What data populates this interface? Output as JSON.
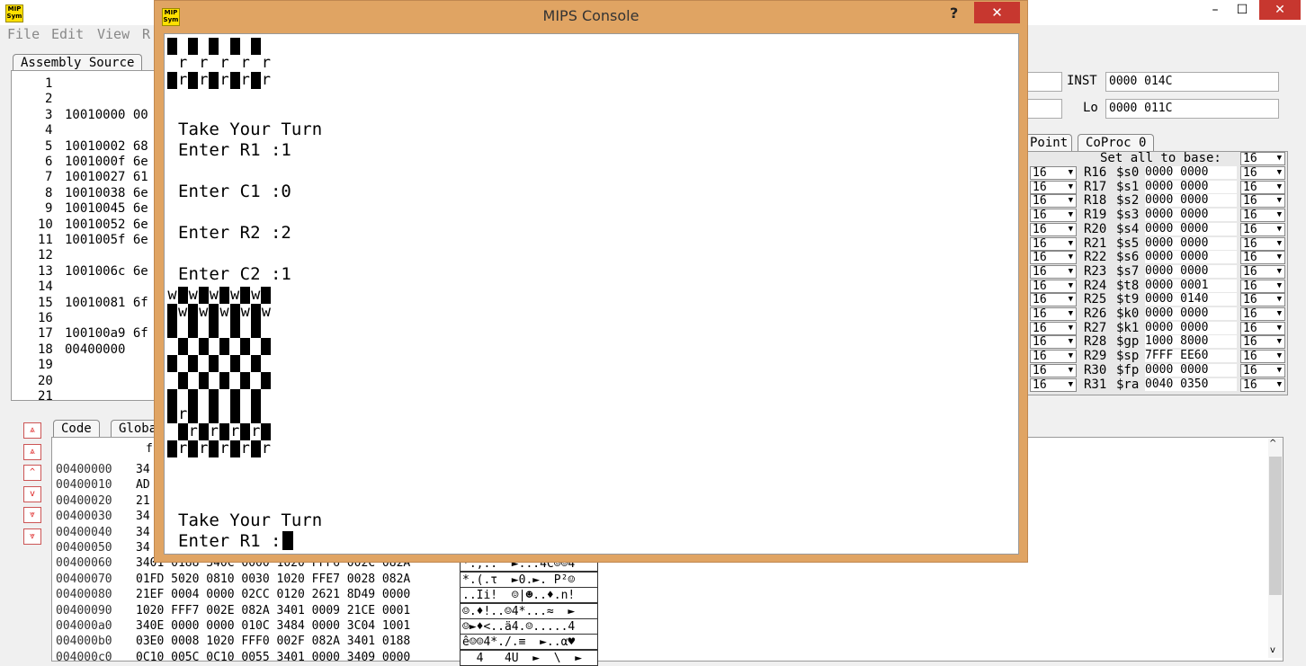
{
  "main_window": {
    "menu": [
      "File",
      "Edit",
      "View",
      "R"
    ],
    "window_controls": [
      "–",
      "☐",
      "✕"
    ]
  },
  "assembly_tab": "Assembly Source",
  "assembly_lines": [
    {
      "n": "1",
      "text": ""
    },
    {
      "n": "2",
      "text": ""
    },
    {
      "n": "3",
      "text": "10010000 00"
    },
    {
      "n": "4",
      "text": ""
    },
    {
      "n": "5",
      "text": "10010002 68"
    },
    {
      "n": "6",
      "text": "1001000f 6e"
    },
    {
      "n": "7",
      "text": "10010027 61"
    },
    {
      "n": "8",
      "text": "10010038 6e"
    },
    {
      "n": "9",
      "text": "10010045 6e"
    },
    {
      "n": "10",
      "text": "10010052 6e"
    },
    {
      "n": "11",
      "text": "1001005f 6e"
    },
    {
      "n": "12",
      "text": ""
    },
    {
      "n": "13",
      "text": "1001006c 6e"
    },
    {
      "n": "14",
      "text": ""
    },
    {
      "n": "15",
      "text": "10010081 6f"
    },
    {
      "n": "16",
      "text": ""
    },
    {
      "n": "17",
      "text": "100100a9 6f"
    },
    {
      "n": "18",
      "text": "00400000"
    },
    {
      "n": "19",
      "text": ""
    },
    {
      "n": "20",
      "text": ""
    },
    {
      "n": "21",
      "text": ""
    }
  ],
  "registers": {
    "inst_label": "INST",
    "inst_value": "0000 014C",
    "lo_label": "Lo",
    "lo_value": "0000 011C",
    "tabs": [
      "Point",
      "CoProc 0"
    ],
    "set_all_label": "Set all to base:",
    "set_all_value": "16",
    "rows": [
      {
        "r": "R16",
        "name": "$s0",
        "value": "0000 0000",
        "base": "16",
        "left_base": "16"
      },
      {
        "r": "R17",
        "name": "$s1",
        "value": "0000 0000",
        "base": "16",
        "left_base": "16"
      },
      {
        "r": "R18",
        "name": "$s2",
        "value": "0000 0000",
        "base": "16",
        "left_base": "16"
      },
      {
        "r": "R19",
        "name": "$s3",
        "value": "0000 0000",
        "base": "16",
        "left_base": "16"
      },
      {
        "r": "R20",
        "name": "$s4",
        "value": "0000 0000",
        "base": "16",
        "left_base": "16"
      },
      {
        "r": "R21",
        "name": "$s5",
        "value": "0000 0000",
        "base": "16",
        "left_base": "16"
      },
      {
        "r": "R22",
        "name": "$s6",
        "value": "0000 0000",
        "base": "16",
        "left_base": "16"
      },
      {
        "r": "R23",
        "name": "$s7",
        "value": "0000 0000",
        "base": "16",
        "left_base": "16"
      },
      {
        "r": "R24",
        "name": "$t8",
        "value": "0000 0001",
        "base": "16",
        "left_base": "16"
      },
      {
        "r": "R25",
        "name": "$t9",
        "value": "0000 0140",
        "base": "16",
        "left_base": "16"
      },
      {
        "r": "R26",
        "name": "$k0",
        "value": "0000 0000",
        "base": "16",
        "left_base": "16"
      },
      {
        "r": "R27",
        "name": "$k1",
        "value": "0000 0000",
        "base": "16",
        "left_base": "16"
      },
      {
        "r": "R28",
        "name": "$gp",
        "value": "1000 8000",
        "base": "16",
        "left_base": "16"
      },
      {
        "r": "R29",
        "name": "$sp",
        "value": "7FFF EE60",
        "base": "16",
        "left_base": "16"
      },
      {
        "r": "R30",
        "name": "$fp",
        "value": "0000 0000",
        "base": "16",
        "left_base": "16"
      },
      {
        "r": "R31",
        "name": "$ra",
        "value": "0040 0350",
        "base": "16",
        "left_base": "16"
      }
    ]
  },
  "memory": {
    "tabs": [
      "Code",
      "Globa"
    ],
    "header_fragment": "f",
    "side_buttons": [
      "⩓",
      "⩓",
      "^",
      "v",
      "⩔",
      "⩔"
    ],
    "rows": [
      {
        "addr": "00400000",
        "words": "34",
        "ascii": ""
      },
      {
        "addr": "00400010",
        "words": "AD",
        "ascii": ""
      },
      {
        "addr": "00400020",
        "words": "21",
        "ascii": ""
      },
      {
        "addr": "00400030",
        "words": "34",
        "ascii": ""
      },
      {
        "addr": "00400040",
        "words": "34",
        "ascii": ""
      },
      {
        "addr": "00400050",
        "words": "34",
        "ascii": ""
      },
      {
        "addr": "00400060",
        "words": "3401 0188 340C 0000 1020 FFF6 002C 082A",
        "ascii": "*.,.:  ►...4C☺☺4"
      },
      {
        "addr": "00400070",
        "words": "01FD 5020 0810 0030 1020 FFE7 0028 082A",
        "ascii": "*.(.τ  ►0.►. P²☺"
      },
      {
        "addr": "00400080",
        "words": "21EF 0004 0000 02CC 0120 2621 8D49 0000",
        "ascii": "..Ii!  ☺|☻..♦.n!"
      },
      {
        "addr": "00400090",
        "words": "1020 FFF7 002E 082A 3401 0009 21CE 0001",
        "ascii": "☺.♦!..☺4*...≈  ►"
      },
      {
        "addr": "004000a0",
        "words": "340E 0000 0000 010C 3484 0000 3C04 1001",
        "ascii": "☺►♦<..ä4.☺.....4"
      },
      {
        "addr": "004000b0",
        "words": "03E0 0008 1020 FFF0 002F 082A 3401 0188",
        "ascii": "ê☺☺4*./.≡  ►..α♥"
      },
      {
        "addr": "004000c0",
        "words": "0C10 005C 0C10 0055 3401 0000 3409 0000",
        "ascii": "  4   4U  ►  \\  ►"
      }
    ]
  },
  "console": {
    "title": "MIPS Console",
    "help": "?",
    "close": "✕",
    "board1": [
      "#.#.#.#.#.",
      ".r.r.r.r.r",
      "#r#r#r#r#r"
    ],
    "prompts1": [
      "Take Your Turn",
      "Enter R1 :1",
      "",
      "Enter C1 :0",
      "",
      "Enter R2 :2",
      "",
      "Enter C2 :1"
    ],
    "board2": [
      "w#w#w#w#w#",
      "#w#w#w#w#w",
      "#.#.#.#.#.",
      ".#.#.#.#.#",
      "#.#.#.#.#.",
      ".#.#.#.#.#",
      "#.#.#.#.#.",
      "#r#.#.#.#.",
      ".#r#r#r#r#",
      "#r#r#r#r#r"
    ],
    "prompts2": [
      "Take Your Turn",
      "Enter R1 :"
    ]
  }
}
